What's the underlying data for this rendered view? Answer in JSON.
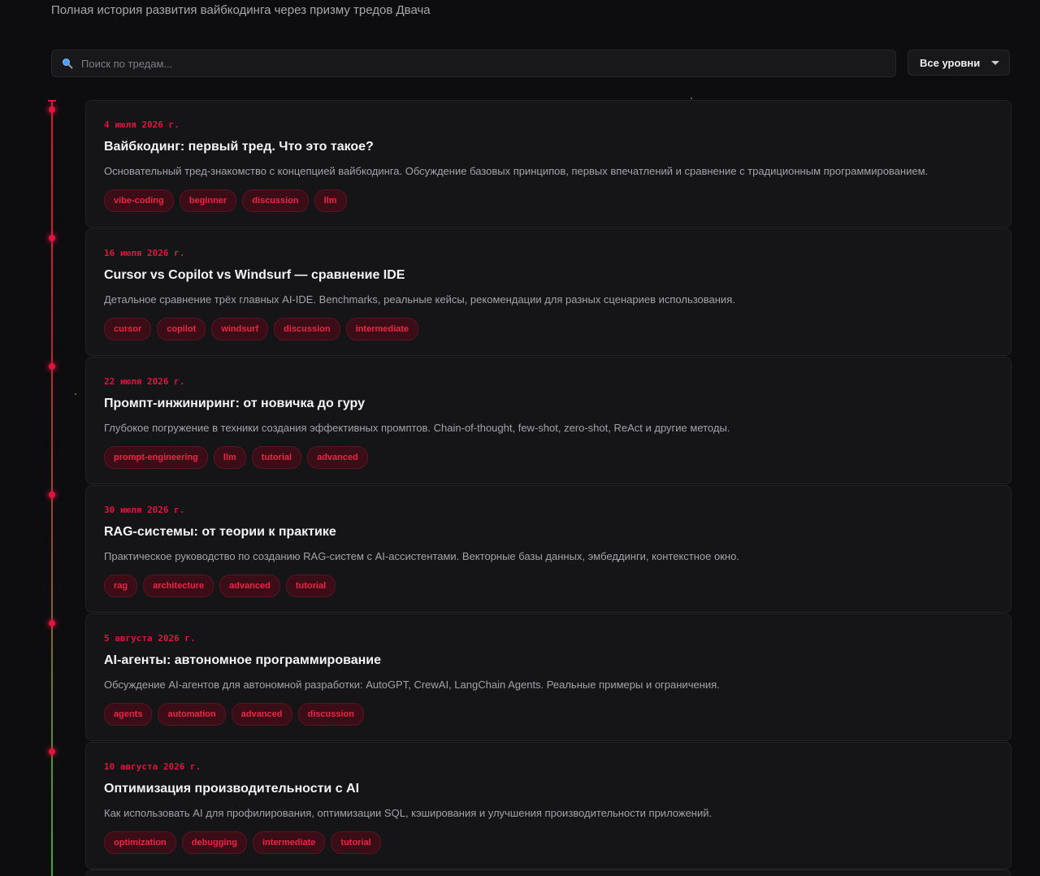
{
  "header": {
    "subtitle": "Полная история развития вайбкодинга через призму тредов Двача"
  },
  "search": {
    "placeholder": "Поиск по тредам...",
    "value": ""
  },
  "level_filter": {
    "selected": "Все уровни"
  },
  "colors": {
    "accent": "#e0143c",
    "background": "#0d0d0f",
    "card": "#151518",
    "tag_bg": "#3a0d17",
    "tag_text": "#ee2346",
    "timeline_end": "#3fa83a"
  },
  "threads": [
    {
      "date": "4 июля 2026 г.",
      "title": "Вайбкодинг: первый тред. Что это такое?",
      "description": "Основательный тред-знакомство с концепцией вайбкодинга. Обсуждение базовых принципов, первых впечатлений и сравнение с традиционным программированием.",
      "tags": [
        "vibe-coding",
        "beginner",
        "discussion",
        "llm"
      ]
    },
    {
      "date": "16 июля 2026 г.",
      "title": "Cursor vs Copilot vs Windsurf — сравнение IDE",
      "description": "Детальное сравнение трёх главных AI-IDE. Benchmarks, реальные кейсы, рекомендации для разных сценариев использования.",
      "tags": [
        "cursor",
        "copilot",
        "windsurf",
        "discussion",
        "intermediate"
      ]
    },
    {
      "date": "22 июля 2026 г.",
      "title": "Промпт-инжиниринг: от новичка до гуру",
      "description": "Глубокое погружение в техники создания эффективных промптов. Chain-of-thought, few-shot, zero-shot, ReAct и другие методы.",
      "tags": [
        "prompt-engineering",
        "llm",
        "tutorial",
        "advanced"
      ]
    },
    {
      "date": "30 июля 2026 г.",
      "title": "RAG-системы: от теории к практике",
      "description": "Практическое руководство по созданию RAG-систем с AI-ассистентами. Векторные базы данных, эмбеддинги, контекстное окно.",
      "tags": [
        "rag",
        "architecture",
        "advanced",
        "tutorial"
      ]
    },
    {
      "date": "5 августа 2026 г.",
      "title": "AI-агенты: автономное программирование",
      "description": "Обсуждение AI-агентов для автономной разработки: AutoGPT, CrewAI, LangChain Agents. Реальные примеры и ограничения.",
      "tags": [
        "agents",
        "automation",
        "advanced",
        "discussion"
      ]
    },
    {
      "date": "10 августа 2026 г.",
      "title": "Оптимизация производительности с AI",
      "description": "Как использовать AI для профилирования, оптимизации SQL, кэширования и улучшения производительности приложений.",
      "tags": [
        "optimization",
        "debugging",
        "intermediate",
        "tutorial"
      ]
    }
  ]
}
